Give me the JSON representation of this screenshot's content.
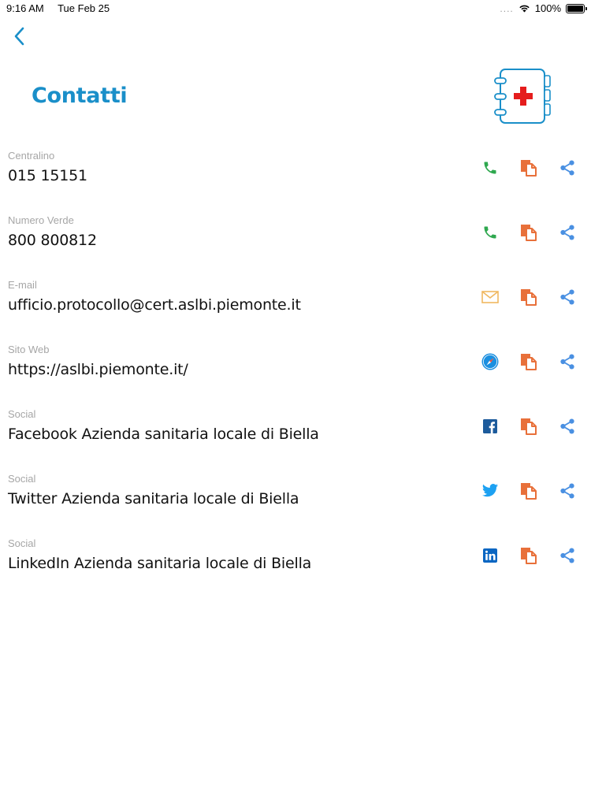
{
  "status_bar": {
    "time": "9:16 AM",
    "date": "Tue Feb 25",
    "signal": "....",
    "battery": "100%"
  },
  "header": {
    "title": "Contatti"
  },
  "colors": {
    "accent": "#1a8fc9",
    "phone": "#2fa84f",
    "copy": "#e8703a",
    "share": "#4a90e2",
    "mail": "#f0b860",
    "facebook": "#1d5b9c",
    "twitter": "#1da1f2",
    "linkedin": "#0a66c2",
    "label": "#a6a6a6"
  },
  "contacts": [
    {
      "label": "Centralino",
      "value": "015 15151",
      "primary_icon": "phone-icon"
    },
    {
      "label": "Numero Verde",
      "value": "800 800812",
      "primary_icon": "phone-icon"
    },
    {
      "label": "E-mail",
      "value": "ufficio.protocollo@cert.aslbi.piemonte.it",
      "primary_icon": "mail-icon"
    },
    {
      "label": "Sito Web",
      "value": "https://aslbi.piemonte.it/",
      "primary_icon": "compass-icon"
    },
    {
      "label": "Social",
      "value": "Facebook Azienda sanitaria locale di Biella",
      "primary_icon": "facebook-icon"
    },
    {
      "label": "Social",
      "value": "Twitter Azienda sanitaria locale di Biella",
      "primary_icon": "twitter-icon"
    },
    {
      "label": "Social",
      "value": "LinkedIn Azienda sanitaria locale di Biella",
      "primary_icon": "linkedin-icon"
    }
  ]
}
